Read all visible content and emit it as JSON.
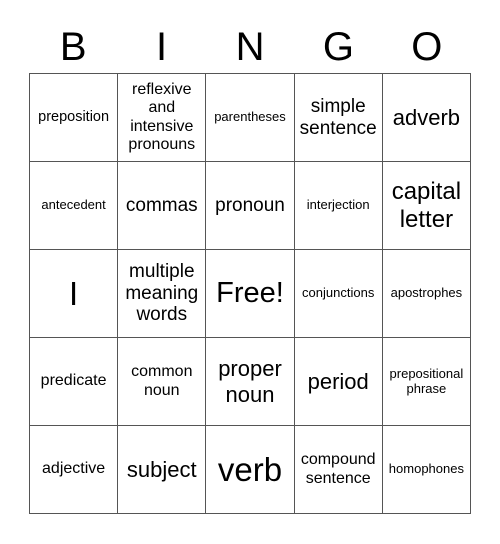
{
  "header": {
    "letters": [
      "B",
      "I",
      "N",
      "G",
      "O"
    ]
  },
  "cells": [
    [
      "preposition",
      "reflexive and intensive pronouns",
      "parentheses",
      "simple sentence",
      "adverb"
    ],
    [
      "antecedent",
      "commas",
      "pronoun",
      "interjection",
      "capital letter"
    ],
    [
      "I",
      "multiple meaning words",
      "Free!",
      "conjunctions",
      "apostrophes"
    ],
    [
      "predicate",
      "common noun",
      "proper noun",
      "period",
      "prepositional phrase"
    ],
    [
      "adjective",
      "subject",
      "verb",
      "compound sentence",
      "homophones"
    ]
  ]
}
